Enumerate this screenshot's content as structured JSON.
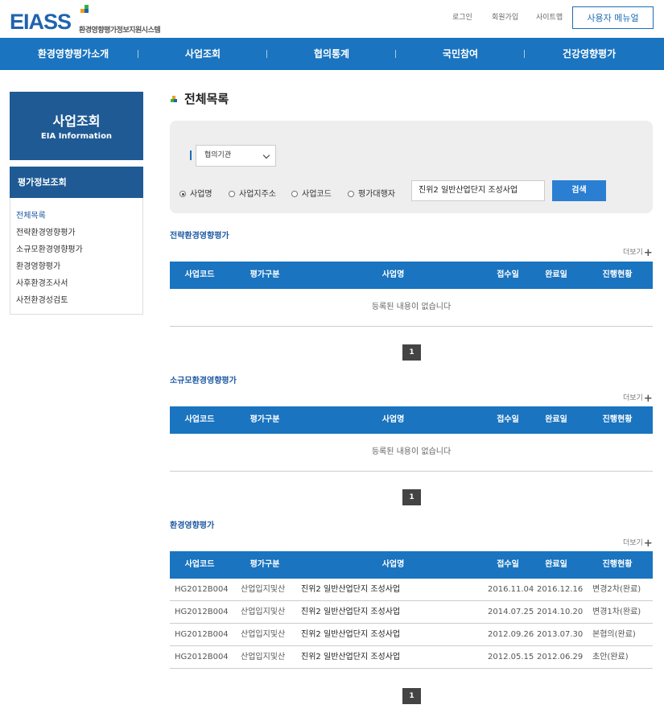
{
  "header": {
    "logo": "EIASS",
    "logo_sub": "환경영향평가정보지원시스템",
    "links": [
      "로그인",
      "회원가입",
      "사이트맵"
    ],
    "user_menu": "사용자 메뉴얼"
  },
  "gnb": [
    "환경영향평가소개",
    "사업조회",
    "협의통계",
    "국민참여",
    "건강영향평가"
  ],
  "sidebar": {
    "title": "사업조회",
    "title_en": "EIA Information",
    "subtitle": "평가정보조회",
    "items": [
      "전체목록",
      "전략환경영향평가",
      "소규모환경영향평가",
      "환경영향평가",
      "사후환경조사서",
      "사전환경성검토"
    ]
  },
  "page_title": "전체목록",
  "search": {
    "select_value": "협의기관",
    "radios": [
      "사업명",
      "사업지주소",
      "사업코드",
      "평가대행자"
    ],
    "input_value": "진위2 일반산업단지 조성사업",
    "button": "검색"
  },
  "columns": [
    "사업코드",
    "평가구분",
    "사업명",
    "접수일",
    "완료일",
    "진행현황"
  ],
  "more_label": "더보기",
  "sections": [
    {
      "title": "전략환경영향평가",
      "empty_text": "등록된 내용이 없습니다",
      "rows": [],
      "page": "1"
    },
    {
      "title": "소규모환경영향평가",
      "empty_text": "등록된 내용이 없습니다",
      "rows": [],
      "page": "1"
    },
    {
      "title": "환경영향평가",
      "rows": [
        {
          "code": "HG2012B004",
          "type": "산업입지및산",
          "name": "진위2 일반산업단지 조성사업",
          "recv": "2016.11.04",
          "done": "2016.12.16",
          "status": "변경2차(완료)"
        },
        {
          "code": "HG2012B004",
          "type": "산업입지및산",
          "name": "진위2 일반산업단지 조성사업",
          "recv": "2014.07.25",
          "done": "2014.10.20",
          "status": "변경1차(완료)"
        },
        {
          "code": "HG2012B004",
          "type": "산업입지및산",
          "name": "진위2 일반산업단지 조성사업",
          "recv": "2012.09.26",
          "done": "2013.07.30",
          "status": "본협의(완료)"
        },
        {
          "code": "HG2012B004",
          "type": "산업입지및산",
          "name": "진위2 일반산업단지 조성사업",
          "recv": "2012.05.15",
          "done": "2012.06.29",
          "status": "초안(완료)"
        }
      ],
      "page": "1"
    }
  ],
  "colors": {
    "brand_blue": "#1a74bf",
    "sidebar_blue": "#1f5a94",
    "button_blue": "#2b7fd3"
  }
}
